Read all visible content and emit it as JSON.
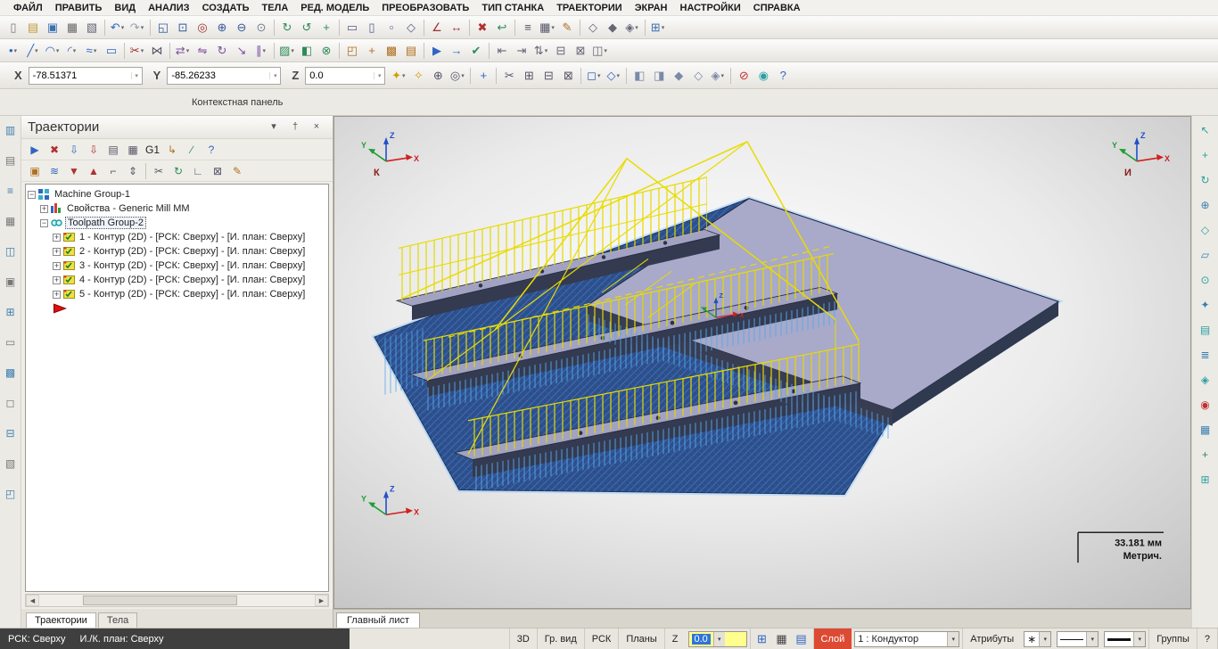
{
  "menu": {
    "items": [
      "ФАЙЛ",
      "ПРАВИТЬ",
      "ВИД",
      "АНАЛИЗ",
      "СОЗДАТЬ",
      "ТЕЛА",
      "РЕД. МОДЕЛЬ",
      "ПРЕОБРАЗОВАТЬ",
      "ТИП СТАНКА",
      "ТРАЕКТОРИИ",
      "ЭКРАН",
      "НАСТРОЙКИ",
      "СПРАВКА"
    ]
  },
  "toolbars": {
    "row1": [
      {
        "name": "new-file",
        "glyph": "▯",
        "color": "#777"
      },
      {
        "name": "open-file",
        "glyph": "▤",
        "color": "#c49a3c"
      },
      {
        "name": "save-file",
        "glyph": "▣",
        "color": "#3a6fb0"
      },
      {
        "name": "print",
        "glyph": "▦",
        "color": "#666"
      },
      {
        "name": "print-preview",
        "glyph": "▧",
        "color": "#667"
      },
      {
        "sep": true
      },
      {
        "name": "undo",
        "glyph": "↶",
        "color": "#2f66c0",
        "dd": true
      },
      {
        "name": "redo",
        "glyph": "↷",
        "color": "#9aa0a8",
        "dd": true
      },
      {
        "sep": true
      },
      {
        "name": "zoom-fit",
        "glyph": "◱",
        "color": "#335a9a"
      },
      {
        "name": "zoom-window",
        "glyph": "⊡",
        "color": "#335a9a"
      },
      {
        "name": "zoom-target",
        "glyph": "◎",
        "color": "#a03030"
      },
      {
        "name": "zoom-in",
        "glyph": "⊕",
        "color": "#335a9a"
      },
      {
        "name": "zoom-out",
        "glyph": "⊖",
        "color": "#335a9a"
      },
      {
        "name": "unzoom",
        "glyph": "⊙",
        "color": "#708090"
      },
      {
        "sep": true
      },
      {
        "name": "repaint",
        "glyph": "↻",
        "color": "#2e8b57"
      },
      {
        "name": "dynamic-rotate",
        "glyph": "↺",
        "color": "#2e8b57"
      },
      {
        "name": "pan",
        "glyph": "+",
        "color": "#2e8b57"
      },
      {
        "sep": true
      },
      {
        "name": "gview-top",
        "glyph": "▭",
        "color": "#555a8a"
      },
      {
        "name": "gview-front",
        "glyph": "▯",
        "color": "#555a8a"
      },
      {
        "name": "gview-side",
        "glyph": "▫",
        "color": "#555a8a"
      },
      {
        "name": "gview-isometric",
        "glyph": "◇",
        "color": "#555a8a"
      },
      {
        "sep": true
      },
      {
        "name": "analyze-position",
        "glyph": "∠",
        "color": "#a03030"
      },
      {
        "name": "analyze-distance",
        "glyph": "↔",
        "color": "#a03030"
      },
      {
        "sep": true
      },
      {
        "name": "delete-entities",
        "glyph": "✖",
        "color": "#b03030"
      },
      {
        "name": "undelete",
        "glyph": "↩",
        "color": "#2e8b57"
      },
      {
        "sep": true
      },
      {
        "name": "levels-manager",
        "glyph": "≡",
        "color": "#556"
      },
      {
        "name": "grid-settings",
        "glyph": "▦",
        "color": "#556",
        "dd": true
      },
      {
        "name": "attributes-settings",
        "glyph": "✎",
        "color": "#b07020"
      },
      {
        "sep": true
      },
      {
        "name": "shading-wireframe",
        "glyph": "◇",
        "color": "#667"
      },
      {
        "name": "shading-solid",
        "glyph": "◆",
        "color": "#667"
      },
      {
        "name": "shading-translucent",
        "glyph": "◈",
        "color": "#667",
        "dd": true
      },
      {
        "sep": true
      },
      {
        "name": "orientation",
        "glyph": "⊞",
        "color": "#3a6fb0",
        "dd": true
      }
    ],
    "row2": [
      {
        "name": "create-point",
        "glyph": "•",
        "color": "#2f66c0",
        "dd": true
      },
      {
        "name": "create-line",
        "glyph": "╱",
        "color": "#2f66c0",
        "dd": true
      },
      {
        "name": "create-arc",
        "glyph": "◠",
        "color": "#2f66c0",
        "dd": true
      },
      {
        "name": "create-fillet",
        "glyph": "◜",
        "color": "#2f66c0",
        "dd": true
      },
      {
        "name": "create-spline",
        "glyph": "≈",
        "color": "#2f66c0",
        "dd": true
      },
      {
        "name": "create-rectangle",
        "glyph": "▭",
        "color": "#2f66c0"
      },
      {
        "sep": true
      },
      {
        "name": "trim-break",
        "glyph": "✂",
        "color": "#a03030",
        "dd": true
      },
      {
        "name": "join-entities",
        "glyph": "⋈",
        "color": "#556"
      },
      {
        "sep": true
      },
      {
        "name": "xform-translate",
        "glyph": "⇄",
        "color": "#7a4ea0",
        "dd": true
      },
      {
        "name": "xform-mirror",
        "glyph": "⇋",
        "color": "#7a4ea0"
      },
      {
        "name": "xform-rotate",
        "glyph": "↻",
        "color": "#7a4ea0"
      },
      {
        "name": "xform-scale",
        "glyph": "↘",
        "color": "#7a4ea0"
      },
      {
        "name": "xform-offset",
        "glyph": "∥",
        "color": "#7a4ea0",
        "dd": true
      },
      {
        "sep": true
      },
      {
        "name": "surface-create",
        "glyph": "▨",
        "color": "#2e8b57",
        "dd": true
      },
      {
        "name": "solid-extrude",
        "glyph": "◧",
        "color": "#2e8b57"
      },
      {
        "name": "solid-boolean",
        "glyph": "⊗",
        "color": "#2e8b57"
      },
      {
        "sep": true
      },
      {
        "name": "toolpath-contour",
        "glyph": "◰",
        "color": "#b07020"
      },
      {
        "name": "toolpath-drill",
        "glyph": "+",
        "color": "#b07020"
      },
      {
        "name": "toolpath-pocket",
        "glyph": "▩",
        "color": "#b07020"
      },
      {
        "name": "toolpath-face",
        "glyph": "▤",
        "color": "#b07020"
      },
      {
        "sep": true
      },
      {
        "name": "machine-simulate",
        "glyph": "▶",
        "color": "#2f66c0"
      },
      {
        "name": "backplot",
        "glyph": "→",
        "color": "#2f66c0"
      },
      {
        "name": "verify",
        "glyph": "✔",
        "color": "#2e8b57"
      },
      {
        "sep": true
      },
      {
        "name": "align-left",
        "glyph": "⇤",
        "color": "#667"
      },
      {
        "name": "align-right",
        "glyph": "⇥",
        "color": "#667"
      },
      {
        "name": "swap-views",
        "glyph": "⇅",
        "color": "#667",
        "dd": true
      },
      {
        "name": "collapse-group",
        "glyph": "⊟",
        "color": "#667"
      },
      {
        "name": "expand-group",
        "glyph": "⊠",
        "color": "#667"
      },
      {
        "name": "window-layout",
        "glyph": "◫",
        "color": "#667",
        "dd": true
      }
    ],
    "coord": [
      {
        "name": "autocursor-settings",
        "glyph": "✦",
        "color": "#d0a000",
        "dd": true
      },
      {
        "name": "autocursor-point",
        "glyph": "✧",
        "color": "#d0a000"
      },
      {
        "name": "cursor-origin",
        "glyph": "⊕",
        "color": "#556"
      },
      {
        "name": "cursor-center",
        "glyph": "◎",
        "color": "#556",
        "dd": true
      },
      {
        "sep": true
      },
      {
        "name": "fast-point",
        "glyph": "+",
        "color": "#2f66c0"
      },
      {
        "sep": true
      },
      {
        "name": "clipboard-cut",
        "glyph": "✂",
        "color": "#556"
      },
      {
        "name": "clipboard-copy",
        "glyph": "⊞",
        "color": "#556"
      },
      {
        "name": "clipboard-paste",
        "glyph": "⊟",
        "color": "#556"
      },
      {
        "name": "screenshot",
        "glyph": "⊠",
        "color": "#556"
      },
      {
        "sep": true
      },
      {
        "name": "selection-window",
        "glyph": "◻",
        "color": "#2f66c0",
        "dd": true
      },
      {
        "name": "selection-polygon",
        "glyph": "◇",
        "color": "#2f66c0",
        "dd": true
      },
      {
        "sep": true
      },
      {
        "name": "pick-front",
        "glyph": "◧",
        "color": "#7a8aa8"
      },
      {
        "name": "pick-back",
        "glyph": "◨",
        "color": "#7a8aa8"
      },
      {
        "name": "pick-solids",
        "glyph": "◆",
        "color": "#7a8aa8"
      },
      {
        "name": "pick-wireframe",
        "glyph": "◇",
        "color": "#7a8aa8"
      },
      {
        "name": "pick-all",
        "glyph": "◈",
        "color": "#7a8aa8",
        "dd": true
      },
      {
        "sep": true
      },
      {
        "name": "clear-selection",
        "glyph": "⊘",
        "color": "#c03030"
      },
      {
        "name": "selection-ok",
        "glyph": "◉",
        "color": "#2aa0a0"
      },
      {
        "name": "help",
        "glyph": "?",
        "color": "#2f66c0"
      }
    ]
  },
  "coordbar": {
    "x_label": "X",
    "x_value": "-78.51371",
    "y_label": "Y",
    "y_value": "-85.26233",
    "z_label": "Z",
    "z_value": "0.0"
  },
  "context_row": {
    "label": "Контекстная панель"
  },
  "left_strip": [
    {
      "name": "dock-ribbon",
      "glyph": "▥",
      "color": "#3f7fae"
    },
    {
      "name": "dock-sketcher",
      "glyph": "▤",
      "color": "#777"
    },
    {
      "name": "dock-function-list",
      "glyph": "≡",
      "color": "#3f7fae"
    },
    {
      "name": "dock-grid",
      "glyph": "▦",
      "color": "#777"
    },
    {
      "name": "dock-multiview",
      "glyph": "◫",
      "color": "#3f7fae"
    },
    {
      "name": "dock-properties",
      "glyph": "▣",
      "color": "#777"
    },
    {
      "name": "dock-add-panel",
      "glyph": "⊞",
      "color": "#3f7fae"
    },
    {
      "name": "dock-plane",
      "glyph": "▭",
      "color": "#777"
    },
    {
      "name": "dock-pattern",
      "glyph": "▩",
      "color": "#3f7fae"
    },
    {
      "name": "dock-blank",
      "glyph": "◻",
      "color": "#777"
    },
    {
      "name": "dock-collapse",
      "glyph": "⊟",
      "color": "#3f7fae"
    },
    {
      "name": "dock-shade",
      "glyph": "▧",
      "color": "#777"
    },
    {
      "name": "dock-corner",
      "glyph": "◰",
      "color": "#3f7fae"
    }
  ],
  "right_strip": [
    {
      "name": "quick-select-pointer",
      "glyph": "↖",
      "color": "#2aa0a0"
    },
    {
      "name": "quick-move",
      "glyph": "+",
      "color": "#2aa0a0"
    },
    {
      "name": "quick-rotate",
      "glyph": "↻",
      "color": "#2aa0a0"
    },
    {
      "name": "quick-origin",
      "glyph": "⊕",
      "color": "#3a7fb0"
    },
    {
      "name": "quick-plane",
      "glyph": "◇",
      "color": "#2aa0a0"
    },
    {
      "name": "quick-parallelogram",
      "glyph": "▱",
      "color": "#3a7fb0"
    },
    {
      "name": "quick-circle",
      "glyph": "⊙",
      "color": "#2aa0a0"
    },
    {
      "name": "quick-star-point",
      "glyph": "✦",
      "color": "#3a7fb0"
    },
    {
      "name": "quick-sheet",
      "glyph": "▤",
      "color": "#2aa0a0"
    },
    {
      "name": "quick-list",
      "glyph": "≣",
      "color": "#3a7fb0"
    },
    {
      "name": "quick-diamond",
      "glyph": "◈",
      "color": "#2aa0a0"
    },
    {
      "name": "quick-target",
      "glyph": "◉",
      "color": "#c03030"
    },
    {
      "name": "quick-grid",
      "glyph": "▦",
      "color": "#3a7fb0"
    },
    {
      "name": "quick-add",
      "glyph": "+",
      "color": "#2e8b57"
    },
    {
      "name": "quick-window",
      "glyph": "⊞",
      "color": "#2aa0a0"
    }
  ],
  "panel": {
    "title": "Траектории",
    "header_icons": [
      {
        "name": "panel-collapse",
        "glyph": "▾",
        "color": "#555"
      },
      {
        "name": "panel-pin",
        "glyph": "†",
        "color": "#555"
      },
      {
        "name": "panel-close",
        "glyph": "×",
        "color": "#555"
      }
    ],
    "tools_row1": [
      {
        "name": "select-all-operations",
        "glyph": "▶",
        "color": "#2f66c0"
      },
      {
        "name": "select-none",
        "glyph": "✖",
        "color": "#b03030"
      },
      {
        "name": "regen-selected",
        "glyph": "⇩",
        "color": "#2f66c0"
      },
      {
        "name": "regen-all-dirty",
        "glyph": "⇩",
        "color": "#b03030"
      },
      {
        "name": "backplot-selected",
        "glyph": "▤",
        "color": "#556"
      },
      {
        "name": "verify-selected",
        "glyph": "▦",
        "color": "#556"
      },
      {
        "name": "post-g1",
        "glyph": "G1",
        "color": "#222"
      },
      {
        "name": "feed-speed-optimize",
        "glyph": "↳",
        "color": "#b07020"
      },
      {
        "name": "toolpath-edit",
        "glyph": "∕",
        "color": "#2e8b57"
      },
      {
        "name": "toolpaths-help",
        "glyph": "?",
        "color": "#2f66c0"
      }
    ],
    "tools_row2": [
      {
        "name": "lock-operations",
        "glyph": "▣",
        "color": "#b07020"
      },
      {
        "name": "toggle-toolpath-display",
        "glyph": "≋",
        "color": "#2f66c0"
      },
      {
        "name": "move-insert-arrow-down",
        "glyph": "▼",
        "color": "#b03030"
      },
      {
        "name": "move-insert-arrow-up",
        "glyph": "▲",
        "color": "#b03030"
      },
      {
        "name": "insert-above",
        "glyph": "⌐",
        "color": "#556"
      },
      {
        "name": "scroll-insert-arrow",
        "glyph": "⇕",
        "color": "#556"
      },
      {
        "sep": true
      },
      {
        "name": "trim-operations",
        "glyph": "✂",
        "color": "#556"
      },
      {
        "name": "recalculate",
        "glyph": "↻",
        "color": "#2e8b57"
      },
      {
        "name": "insert-corner",
        "glyph": "∟",
        "color": "#556"
      },
      {
        "name": "remove-display",
        "glyph": "⊠",
        "color": "#556"
      },
      {
        "name": "edit-parameters",
        "glyph": "✎",
        "color": "#b07020"
      }
    ],
    "tree": {
      "machine_group": "Machine Group-1",
      "properties": "Свойства - Generic Mill MM",
      "toolpath_group": "Toolpath Group-2",
      "operations": [
        "1 - Контур (2D) - [РСК: Сверху] - [И. план: Сверху]",
        "2 - Контур (2D) - [РСК: Сверху] - [И. план: Сверху]",
        "3 - Контур (2D) - [РСК: Сверху] - [И. план: Сверху]",
        "4 - Контур (2D) - [РСК: Сверху] - [И. план: Сверху]",
        "5 - Контур (2D) - [РСК: Сверху] - [И. план: Сверху]"
      ]
    },
    "tabs": [
      {
        "label": "Траектории",
        "active": true
      },
      {
        "label": "Тела",
        "active": false
      }
    ]
  },
  "viewport": {
    "tab": "Главный лист",
    "scale_value": "33.181 мм",
    "scale_units": "Метрич.",
    "gizmo_top_left": "К",
    "gizmo_top_right": "И",
    "axis_x": "X",
    "axis_y": "Y",
    "axis_z": "Z"
  },
  "statusbar": {
    "wcs_text": "РСК: Сверху",
    "plane_text": "И./К. план: Сверху",
    "btn_3d": "3D",
    "btn_gview": "Гр. вид",
    "btn_wcs": "РСК",
    "btn_planes": "Планы",
    "z_label": "Z",
    "z_value": "0.0",
    "icons": [
      {
        "name": "section-view",
        "glyph": "⊞",
        "color": "#2f66c0"
      },
      {
        "name": "blank-hide",
        "glyph": "▦",
        "color": "#444"
      },
      {
        "name": "viewsheet-bookmark",
        "glyph": "▤",
        "color": "#2f66c0"
      }
    ],
    "layer_label": "Слой",
    "layer_value": "1 : Кондуктор",
    "btn_attributes": "Атрибуты",
    "point_style_glyph": "∗",
    "btn_groups": "Группы",
    "btn_help": "?"
  },
  "colors": {
    "toolpath_yellow": "#e8dc00",
    "model_blue": "#2c4f8c",
    "surface_lavender": "#a9a9c9",
    "layer_red": "#dd4a33",
    "z_field_yellow": "#ffff8e",
    "selection_blue": "#2f74d8"
  }
}
